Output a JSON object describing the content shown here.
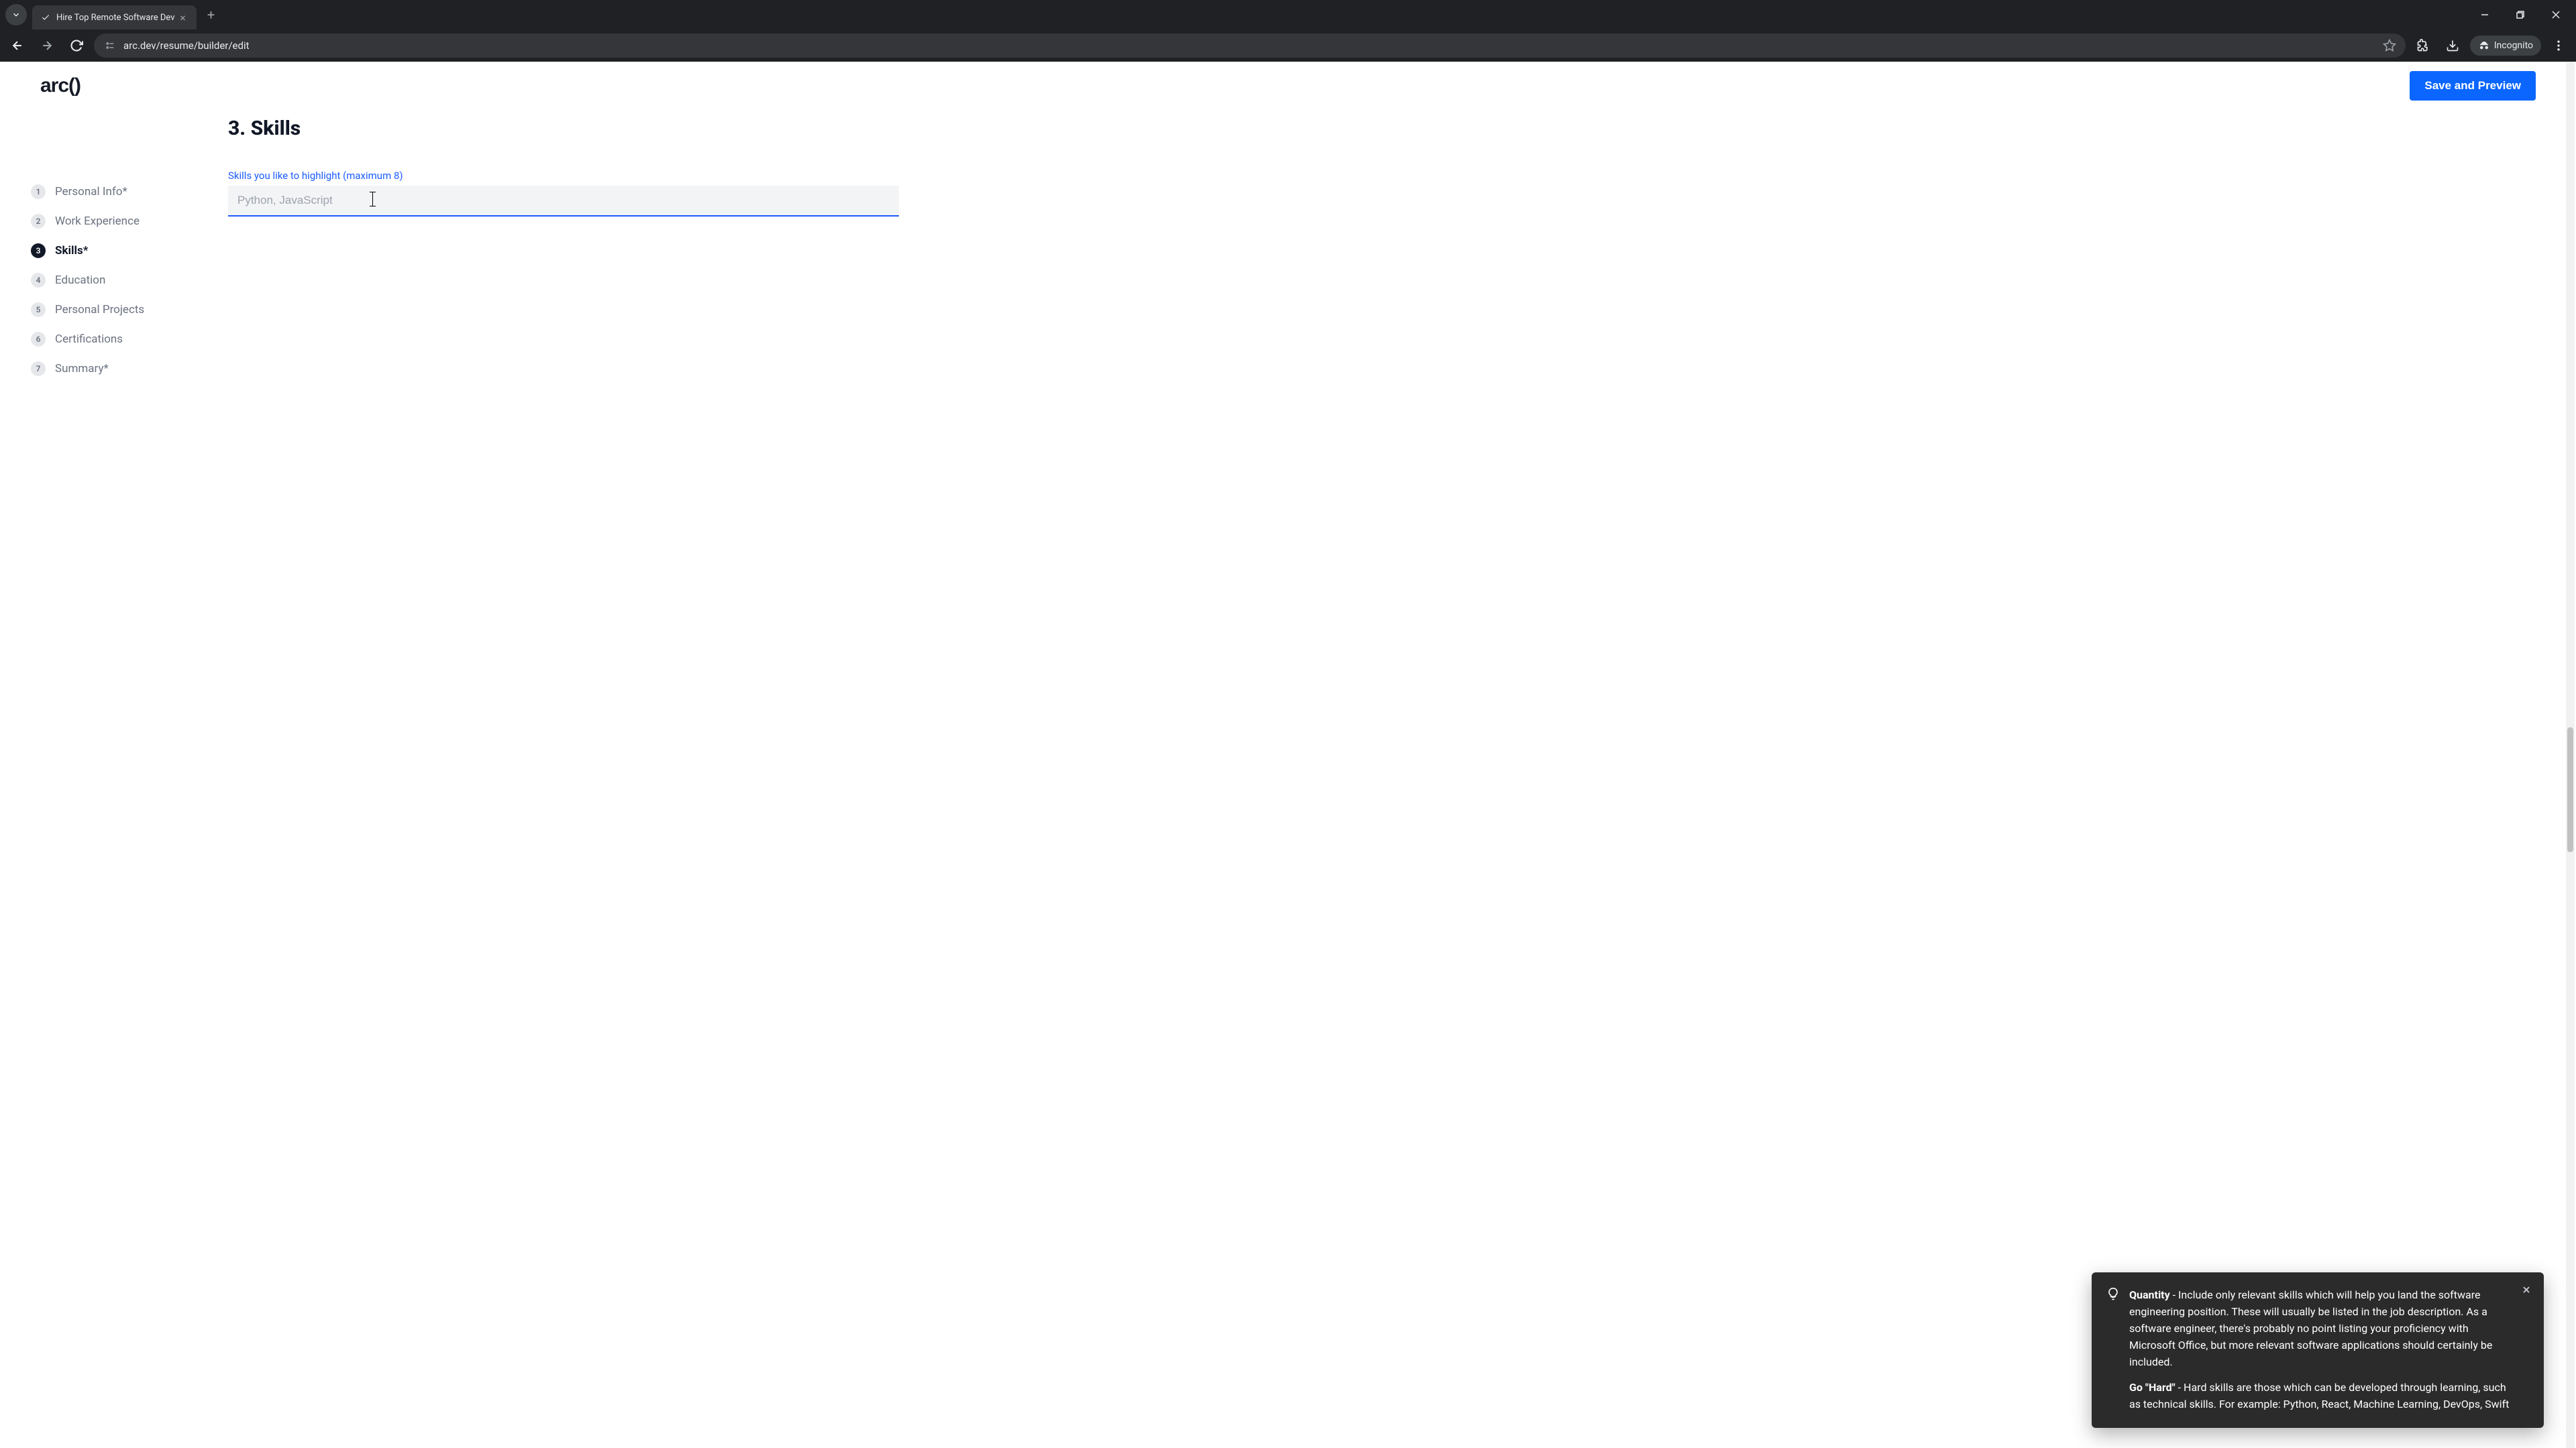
{
  "browser": {
    "tab_title": "Hire Top Remote Software Dev",
    "url": "arc.dev/resume/builder/edit",
    "incognito_label": "Incognito"
  },
  "header": {
    "logo": "arc()",
    "save_button": "Save and Preview"
  },
  "sidebar": {
    "items": [
      {
        "num": "1",
        "label": "Personal Info*"
      },
      {
        "num": "2",
        "label": "Work Experience"
      },
      {
        "num": "3",
        "label": "Skills*"
      },
      {
        "num": "4",
        "label": "Education"
      },
      {
        "num": "5",
        "label": "Personal Projects"
      },
      {
        "num": "6",
        "label": "Certifications"
      },
      {
        "num": "7",
        "label": "Summary*"
      }
    ]
  },
  "main": {
    "section_title": "3. Skills",
    "field_label": "Skills you like to highlight (maximum 8)",
    "input_placeholder": "Python, JavaScript",
    "input_value": ""
  },
  "tooltip": {
    "tip1_bold": "Quantity",
    "tip1_rest": " - Include only relevant skills which will help you land the software engineering position. These will usually be listed in the job description. As a software engineer, there's probably no point listing your proficiency with Microsoft Office, but more relevant software applications should certainly be included.",
    "tip2_bold": "Go \"Hard\"",
    "tip2_rest": " - Hard skills are those which can be developed through learning, such as technical skills. For example: Python, React, Machine Learning, DevOps, Swift"
  }
}
